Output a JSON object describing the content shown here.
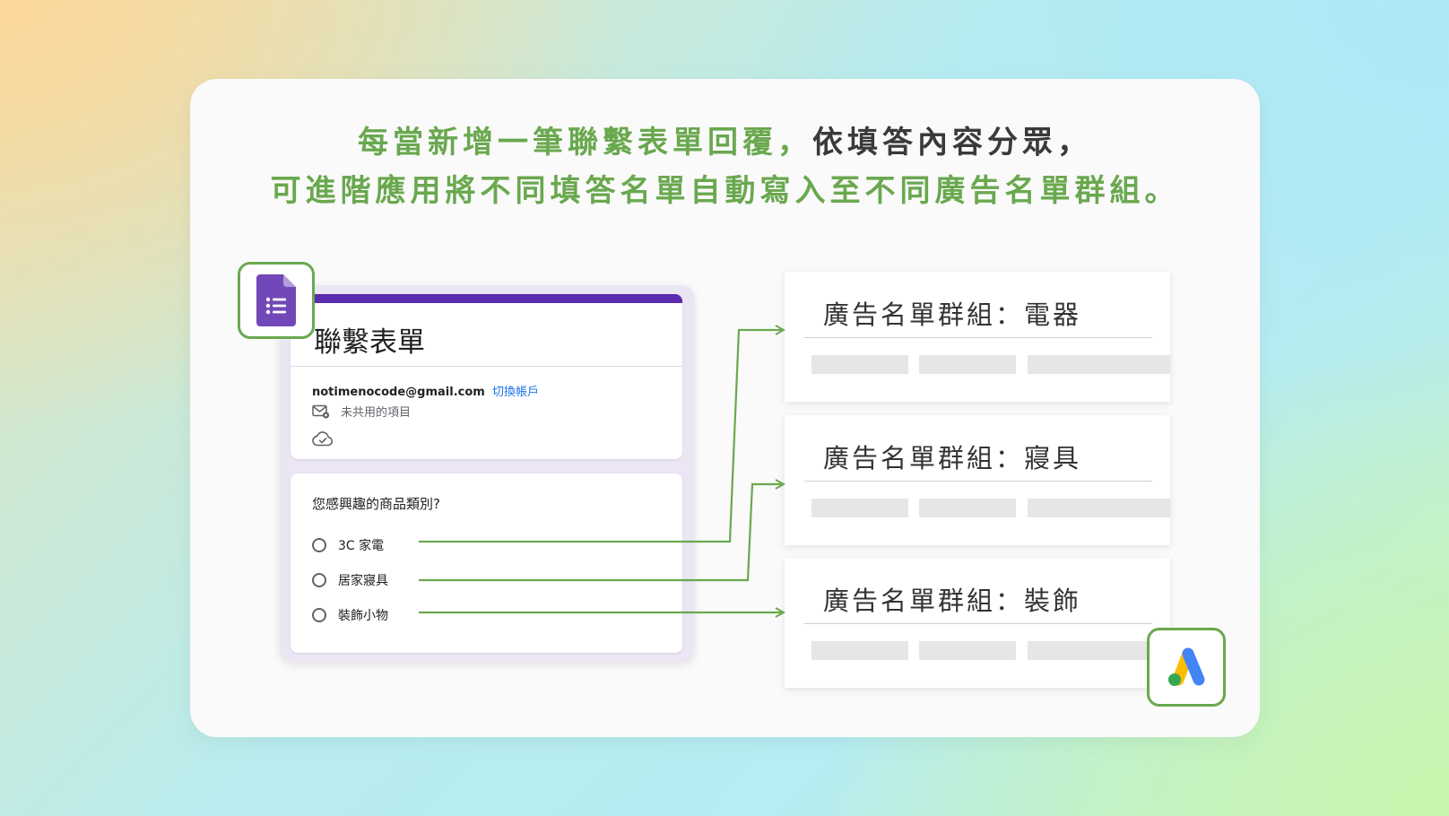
{
  "headline": {
    "line1_green": "每當新增一筆聯繫表單回覆，",
    "line1_dark": "依填答內容分眾，",
    "line2": "可進階應用將不同填答名單自動寫入至不同廣告名單群組。"
  },
  "form": {
    "title": "聯繫表單",
    "email": "notimenocode@gmail.com",
    "switch_account": "切換帳戶",
    "unshared_label": "未共用的項目",
    "question": "您感興趣的商品類別?",
    "options": [
      "3C 家電",
      "居家寢具",
      "裝飾小物"
    ]
  },
  "ad_groups": [
    {
      "title": "廣告名單群組：電器"
    },
    {
      "title": "廣告名單群組：寢具"
    },
    {
      "title": "廣告名單群組：裝飾"
    }
  ],
  "colors": {
    "accent_green": "#6aa84f",
    "forms_purple": "#5b2bb0",
    "link_blue": "#1a73e8",
    "ads_blue": "#4285f4",
    "ads_yellow": "#fbbc04",
    "ads_green": "#34a853"
  },
  "icons": {
    "forms_app": "google-forms-icon",
    "ads_app": "google-ads-icon",
    "mail": "mail-settings-icon",
    "cloud": "cloud-check-icon"
  }
}
